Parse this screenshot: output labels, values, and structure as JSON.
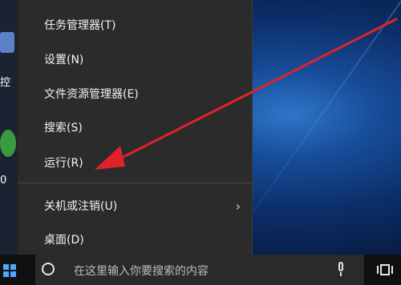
{
  "context_menu": {
    "items": [
      {
        "label": "任务管理器(T)"
      },
      {
        "label": "设置(N)"
      },
      {
        "label": "文件资源管理器(E)"
      },
      {
        "label": "搜索(S)"
      },
      {
        "label": "运行(R)"
      },
      {
        "label": "关机或注销(U)",
        "submenu_indicator": "›"
      },
      {
        "label": "桌面(D)"
      }
    ]
  },
  "desktop": {
    "icon_text_1": "控",
    "icon_text_2": "0"
  },
  "taskbar": {
    "search_placeholder": "在这里输入你要搜索的内容",
    "icons": [
      "windows-start-icon",
      "cortana-icon",
      "microphone-icon",
      "task-view-icon"
    ]
  },
  "annotation": {
    "arrow_color": "#e0222a"
  }
}
